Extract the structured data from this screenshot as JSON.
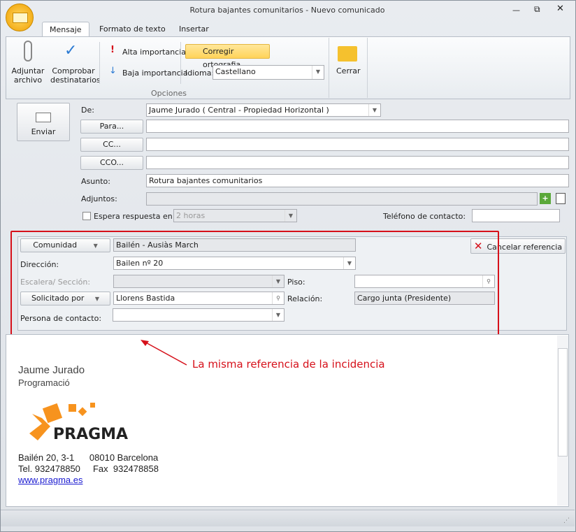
{
  "window": {
    "title": "Rotura bajantes comunitarios - Nuevo comunicado",
    "controls": [
      "minimize",
      "restore",
      "close"
    ]
  },
  "tabs": [
    {
      "label": "Mensaje",
      "active": true
    },
    {
      "label": "Formato de texto"
    },
    {
      "label": "Insertar"
    }
  ],
  "ribbon": {
    "attach": "Adjuntar archivo",
    "check": "Comprobar destinatarios",
    "high": "Alta importancia",
    "low": "Baja importancia",
    "spell": "Corregir ortografia",
    "lang_label": "Idioma:",
    "lang_value": "Castellano",
    "group_label": "Opciones",
    "close": "Cerrar"
  },
  "form": {
    "send": "Enviar",
    "from_label": "De:",
    "from_value": "Jaume Jurado ( Central - Propiedad Horizontal )",
    "to": "Para...",
    "cc": "CC...",
    "bcc": "CCO...",
    "subject_label": "Asunto:",
    "subject_value": "Rotura bajantes comunitarios",
    "attachments_label": "Adjuntos:",
    "wait_label": "Espera respuesta en:",
    "wait_value": "2 horas",
    "phone_label": "Teléfono de contacto:"
  },
  "reference": {
    "community_btn": "Comunidad",
    "community_value": "Bailén - Ausiàs March",
    "cancel": "Cancelar referencia",
    "address_label": "Dirección:",
    "address_value": "Bailen nº 20",
    "stair_label": "Escalera/ Sección:",
    "floor_label": "Piso:",
    "requested_btn": "Solicitado por",
    "requested_value": "Llorens Bastida",
    "relation_label": "Relación:",
    "relation_value": "Cargo junta (Presidente)",
    "contact_label": "Persona de contacto:"
  },
  "annotation": "La misma referencia de la incidencia",
  "signature": {
    "name": "Jaume Jurado",
    "role": "Programació",
    "logo": "PRAGMA",
    "address": "Bailén 20, 3-1      08010 Barcelona",
    "phone": "Tel. 932478850     Fax  932478858",
    "web": "www.pragma.es"
  }
}
